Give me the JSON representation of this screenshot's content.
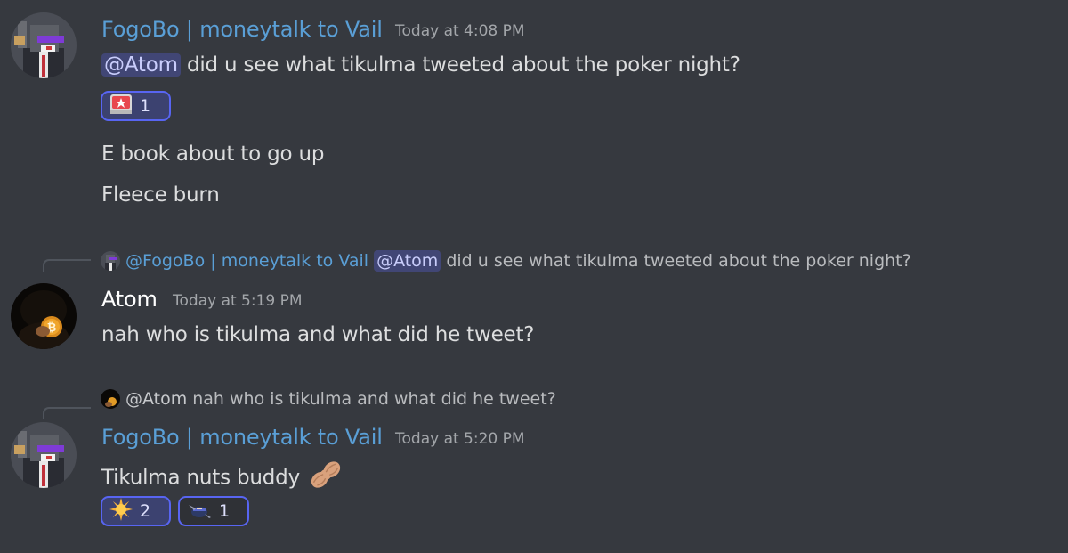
{
  "messages": [
    {
      "username": "FogoBo | moneytalk to Vail",
      "timestamp": "Today at 4:08 PM",
      "mention": "@Atom",
      "text": "did u see what tikulma tweeted about the poker night?",
      "reactions": [
        {
          "icon": "rotating-light-icon",
          "count": "1"
        }
      ],
      "followups": [
        "E book about to go up",
        "Fleece burn"
      ]
    },
    {
      "reply": {
        "name": "@FogoBo | moneytalk to Vail",
        "mention": "@Atom",
        "text": "did u see what tikulma tweeted about the poker night?"
      },
      "username": "Atom",
      "timestamp": "Today at 5:19 PM",
      "text": "nah who is tikulma and what did he tweet?"
    },
    {
      "reply": {
        "name": "@Atom",
        "text": "nah who is tikulma and what did he tweet?"
      },
      "username": "FogoBo | moneytalk to Vail",
      "timestamp": "Today at 5:20 PM",
      "text": "Tikulma nuts buddy",
      "text_emoji": "peanut-icon",
      "reactions": [
        {
          "icon": "sun-icon",
          "count": "2"
        },
        {
          "icon": "ninja-icon",
          "count": "1"
        }
      ]
    }
  ],
  "colors": {
    "background": "#36393f",
    "username": "#5a9fd6",
    "mention_bg": "#414675",
    "reaction_border": "#5865f2"
  }
}
